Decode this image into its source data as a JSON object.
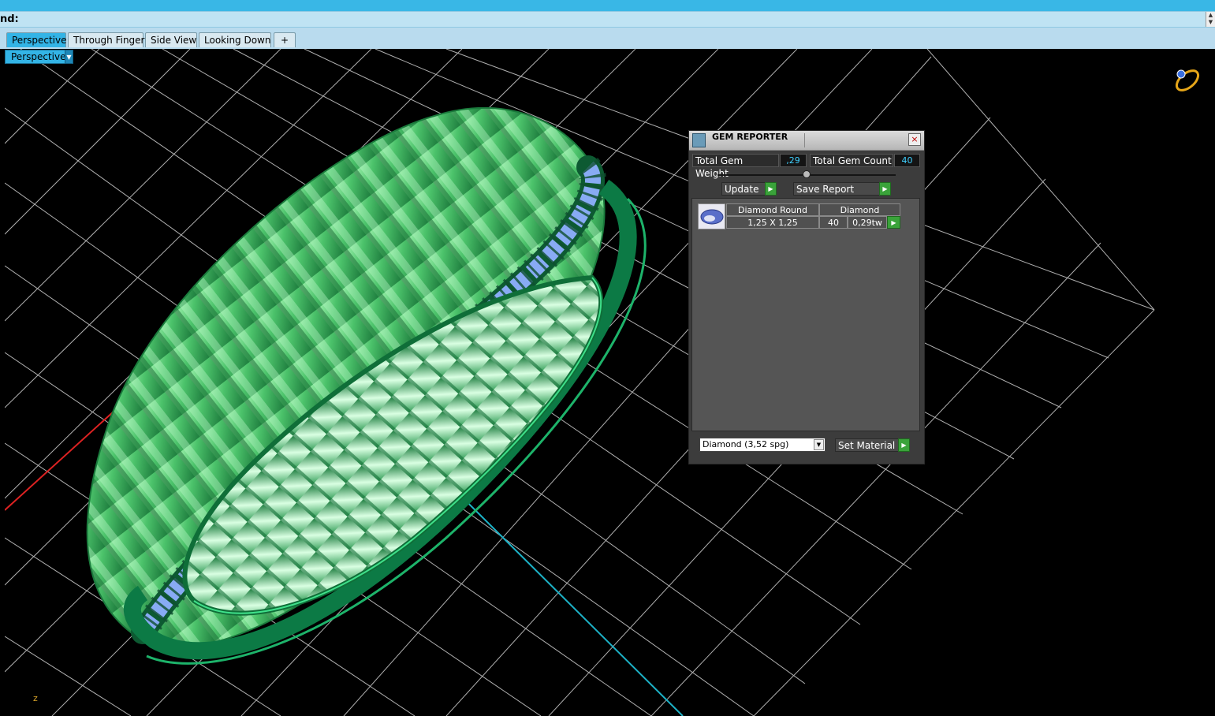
{
  "command_bar": {
    "label": "nd:"
  },
  "view_tabs": [
    "Perspective",
    "Through Finger",
    "Side View",
    "Looking Down"
  ],
  "add_tab_symbol": "+",
  "viewport": {
    "view_selector": "Perspective",
    "axis_label": "z"
  },
  "gem_reporter": {
    "title": "GEM REPORTER",
    "close_symbol": "×",
    "total_weight_label": "Total Gem Weight",
    "total_weight_value": ",29",
    "total_count_label": "Total Gem Count",
    "total_count_value": "40",
    "update_label": "Update",
    "save_report_label": "Save Report",
    "gem_entry": {
      "shape": "Diamond Round",
      "material": "Diamond",
      "size": "1,25 X 1,25",
      "count": "40",
      "weight": "0,29tw"
    },
    "material_select_value": "Diamond     (3,52 spg)",
    "set_material_label": "Set Material"
  },
  "colors": {
    "accent_blue": "#33b4e6",
    "ring_green": "#3fbf63",
    "gem_blue": "#8fb0ff",
    "go_green": "#3aa33a"
  }
}
